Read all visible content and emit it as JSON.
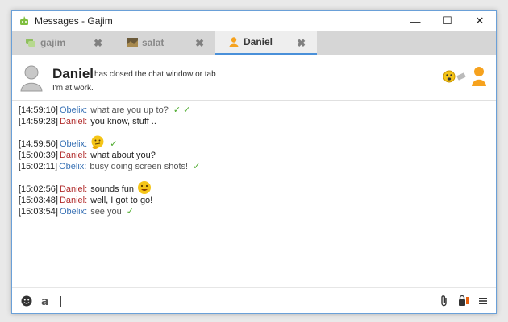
{
  "window": {
    "title": "Messages - Gajim",
    "minimize": "—",
    "maximize": "☐",
    "close": "✕"
  },
  "tabs": [
    {
      "label": "gajim",
      "icon": "group-chat-icon",
      "active": false
    },
    {
      "label": "salat",
      "icon": "contact-photo-icon",
      "active": false
    },
    {
      "label": "Daniel",
      "icon": "person-icon",
      "active": true
    }
  ],
  "tab_close": "✖",
  "header": {
    "name": "Daniel",
    "status": "has closed the chat window or tab",
    "status_message": "I'm at work."
  },
  "messages": [
    {
      "time": "[14:59:10]",
      "nick": "Obelix:",
      "text": "what are you up to?",
      "dir": "out",
      "checks": "✓ ✓"
    },
    {
      "time": "[14:59:28]",
      "nick": "Daniel:",
      "text": "you know, stuff ..",
      "dir": "in",
      "checks": ""
    },
    {
      "time": "[14:59:50]",
      "nick": "Obelix:",
      "text": "",
      "dir": "out",
      "checks": "✓",
      "emoji": "thinking-emoji"
    },
    {
      "time": "[15:00:39]",
      "nick": "Daniel:",
      "text": "what about you?",
      "dir": "in",
      "checks": ""
    },
    {
      "time": "[15:02:11]",
      "nick": "Obelix:",
      "text": "busy doing screen shots!",
      "dir": "out",
      "checks": "✓"
    },
    {
      "time": "[15:02:56]",
      "nick": "Daniel:",
      "text": "sounds fun",
      "dir": "in",
      "checks": "",
      "emoji": "smile-emoji"
    },
    {
      "time": "[15:03:48]",
      "nick": "Daniel:",
      "text": "well, I got to go!",
      "dir": "in",
      "checks": ""
    },
    {
      "time": "[15:03:54]",
      "nick": "Obelix:",
      "text": "see you",
      "dir": "out",
      "checks": "✓"
    }
  ],
  "input": {
    "value": "",
    "left_icons": [
      "emoji-icon",
      "format-icon"
    ],
    "right_icons": [
      "attach-icon",
      "encryption-icon",
      "menu-icon"
    ]
  },
  "colors": {
    "accent": "#4a90d9",
    "own_nick": "#3972b5",
    "contact_nick": "#b12b2b",
    "check": "#4caa2c"
  }
}
